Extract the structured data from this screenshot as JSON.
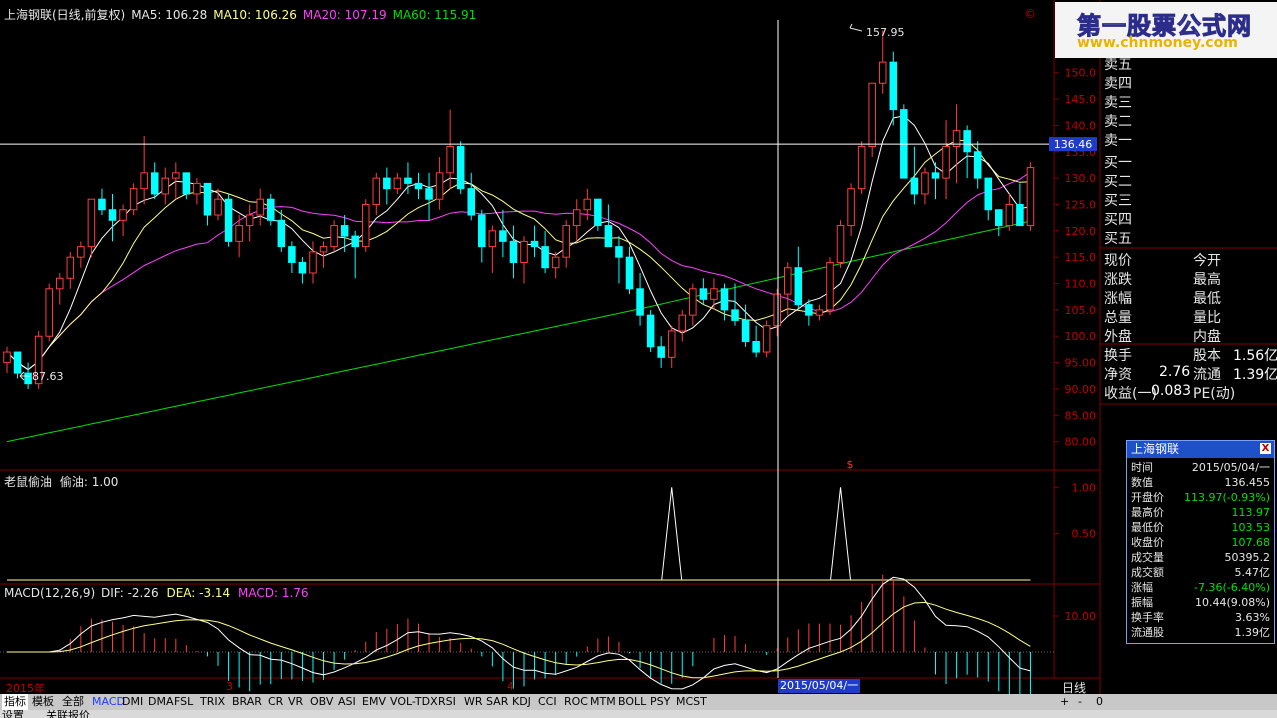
{
  "header": {
    "stock_title": "上海钢联(日线,前复权)",
    "ma5": "MA5: 106.28",
    "ma10": "MA10: 106.26",
    "ma20": "MA20: 107.19",
    "ma60": "MA60: 115.91"
  },
  "colors": {
    "up": "#ff3c3c",
    "down": "#00ffff",
    "ma5": "#ffffff",
    "ma10": "#ffff80",
    "ma20": "#ff40ff",
    "ma60": "#00e000",
    "axis": "#800000",
    "crosshair": "#ffffff"
  },
  "chart_data": [
    {
      "type": "candlestick",
      "title": "上海钢联(日线,前复权)",
      "ylim": [
        75,
        160
      ],
      "y_ticks": [
        "80.00",
        "85.00",
        "90.00",
        "95.00",
        "100.0",
        "105.0",
        "110.0",
        "115.0",
        "120.0",
        "125.0",
        "130.0",
        "135.0",
        "140.0",
        "145.0",
        "150.0"
      ],
      "crosshair_value": "136.46",
      "max_label": "157.95",
      "min_label": "87.63",
      "candles": [
        [
          95,
          98,
          93,
          97
        ],
        [
          97,
          96,
          92,
          93
        ],
        [
          93,
          95,
          90,
          91
        ],
        [
          91,
          101,
          90,
          100
        ],
        [
          100,
          110,
          99,
          109
        ],
        [
          109,
          112,
          106,
          111
        ],
        [
          111,
          116,
          109,
          115
        ],
        [
          115,
          118,
          113,
          117
        ],
        [
          117,
          126,
          115,
          126
        ],
        [
          126,
          128,
          123,
          124
        ],
        [
          124,
          127,
          118,
          122
        ],
        [
          122,
          125,
          119,
          124
        ],
        [
          124,
          129,
          123,
          128
        ],
        [
          128,
          138,
          125,
          131
        ],
        [
          131,
          133,
          126,
          127
        ],
        [
          127,
          132,
          125,
          130
        ],
        [
          130,
          133,
          126,
          131
        ],
        [
          131,
          131,
          126,
          127
        ],
        [
          127,
          130,
          125,
          129
        ],
        [
          129,
          129,
          121,
          123
        ],
        [
          123,
          128,
          122,
          126
        ],
        [
          126,
          127,
          117,
          118
        ],
        [
          118,
          123,
          115,
          121
        ],
        [
          121,
          125,
          118,
          123
        ],
        [
          123,
          128,
          121,
          126
        ],
        [
          126,
          127,
          121,
          122
        ],
        [
          122,
          124,
          116,
          117
        ],
        [
          117,
          118,
          112,
          114
        ],
        [
          114,
          115,
          110,
          112
        ],
        [
          112,
          118,
          110,
          116
        ],
        [
          116,
          118,
          113,
          117
        ],
        [
          117,
          122,
          116,
          121
        ],
        [
          121,
          123,
          116,
          119
        ],
        [
          119,
          120,
          111,
          117
        ],
        [
          117,
          126,
          116,
          125
        ],
        [
          125,
          131,
          123,
          130
        ],
        [
          130,
          132,
          125,
          128
        ],
        [
          128,
          131,
          127,
          130
        ],
        [
          130,
          133,
          127,
          129
        ],
        [
          129,
          131,
          126,
          128
        ],
        [
          128,
          131,
          122,
          126
        ],
        [
          126,
          134,
          124,
          131
        ],
        [
          131,
          143,
          128,
          136
        ],
        [
          136,
          137,
          127,
          128
        ],
        [
          128,
          131,
          122,
          123
        ],
        [
          123,
          124,
          114,
          117
        ],
        [
          117,
          121,
          112,
          120
        ],
        [
          120,
          124,
          115,
          118
        ],
        [
          118,
          121,
          111,
          114
        ],
        [
          114,
          119,
          110,
          118
        ],
        [
          118,
          121,
          115,
          117
        ],
        [
          117,
          120,
          112,
          113
        ],
        [
          113,
          116,
          111,
          115
        ],
        [
          115,
          122,
          113,
          121
        ],
        [
          121,
          126,
          118,
          124
        ],
        [
          124,
          128,
          122,
          126
        ],
        [
          126,
          126,
          120,
          121
        ],
        [
          121,
          125,
          118,
          117
        ],
        [
          117,
          119,
          110,
          115
        ],
        [
          115,
          117,
          108,
          109
        ],
        [
          109,
          112,
          102,
          104
        ],
        [
          104,
          105,
          97,
          98
        ],
        [
          98,
          100,
          94,
          96
        ],
        [
          96,
          102,
          94,
          101
        ],
        [
          101,
          105,
          99,
          104
        ],
        [
          104,
          110,
          102,
          109
        ],
        [
          109,
          111,
          106,
          107
        ],
        [
          107,
          111,
          105,
          109
        ],
        [
          109,
          110,
          103,
          105
        ],
        [
          105,
          110,
          102,
          103
        ],
        [
          103,
          106,
          98,
          99
        ],
        [
          99,
          102,
          96,
          97
        ],
        [
          97,
          103,
          96,
          102
        ],
        [
          102,
          109,
          100,
          108
        ],
        [
          108,
          114,
          104,
          113
        ],
        [
          113,
          117,
          105,
          106
        ],
        [
          106,
          107,
          102,
          104
        ],
        [
          104,
          106,
          103,
          105
        ],
        [
          105,
          115,
          104,
          114
        ],
        [
          114,
          122,
          113,
          121
        ],
        [
          121,
          129,
          119,
          128
        ],
        [
          128,
          137,
          127,
          136
        ],
        [
          136,
          144,
          134,
          148
        ],
        [
          148,
          158,
          146,
          152
        ],
        [
          152,
          154,
          140,
          143
        ],
        [
          143,
          144,
          130,
          130
        ],
        [
          130,
          136,
          125,
          127
        ],
        [
          127,
          132,
          125,
          131
        ],
        [
          131,
          133,
          126,
          130
        ],
        [
          130,
          141,
          126,
          136
        ],
        [
          136,
          144,
          129,
          139
        ],
        [
          139,
          140,
          130,
          135
        ],
        [
          135,
          137,
          128,
          130
        ],
        [
          130,
          128,
          122,
          124
        ],
        [
          124,
          124,
          119,
          121
        ],
        [
          121,
          127,
          120,
          125
        ],
        [
          125,
          129,
          121,
          121
        ],
        [
          121,
          133,
          120,
          132
        ]
      ],
      "series": [
        {
          "name": "MA5"
        },
        {
          "name": "MA10"
        },
        {
          "name": "MA20"
        },
        {
          "name": "MA60"
        }
      ]
    },
    {
      "type": "line",
      "title": "老鼠偷油",
      "series_label": "偷油: 1.00",
      "y_ticks": [
        "0.50",
        "1.00"
      ],
      "ylim": [
        0,
        1.1
      ],
      "spikes_at_index": [
        63,
        79
      ]
    },
    {
      "type": "bar",
      "title": "MACD(12,26,9)",
      "dif_label": "DIF: -2.26",
      "dea_label": "DEA: -3.14",
      "macd_label": "MACD: 1.76",
      "y_ticks": [
        "10.00"
      ]
    }
  ],
  "right_panel": {
    "asks": [
      "卖五",
      "卖四",
      "卖三",
      "卖二",
      "卖一"
    ],
    "bids": [
      "买一",
      "买二",
      "买三",
      "买四",
      "买五"
    ],
    "stats_left": [
      "现价",
      "涨跌",
      "涨幅",
      "总量",
      "外盘"
    ],
    "stats_right": [
      "今开",
      "最高",
      "最低",
      "量比",
      "内盘"
    ],
    "turnover_label": "换手",
    "equity_label": "股本",
    "equity_value": "1.56亿",
    "net_assets_label": "净资",
    "net_assets_value": "2.76",
    "float_label": "流通",
    "float_value": "1.39亿",
    "eps_label": "收益(一)",
    "eps_value": "0.083",
    "pe_label": "PE(动)"
  },
  "info_box": {
    "title": "上海钢联",
    "close": "X",
    "rows": [
      {
        "k": "时间",
        "v": "2015/05/04/一",
        "c": "#e6e6e6"
      },
      {
        "k": "数值",
        "v": "136.455",
        "c": "#e6e6e6"
      },
      {
        "k": "开盘价",
        "v": "113.97(-0.93%)",
        "c": "#00e000"
      },
      {
        "k": "最高价",
        "v": "113.97",
        "c": "#00e000"
      },
      {
        "k": "最低价",
        "v": "103.53",
        "c": "#00e000"
      },
      {
        "k": "收盘价",
        "v": "107.68",
        "c": "#00e000"
      },
      {
        "k": "成交量",
        "v": "50395.2",
        "c": "#e6e6e6"
      },
      {
        "k": "成交额",
        "v": "5.47亿",
        "c": "#e6e6e6"
      },
      {
        "k": "涨幅",
        "v": "-7.36(-6.40%)",
        "c": "#00e000"
      },
      {
        "k": "振幅",
        "v": "10.44(9.08%)",
        "c": "#e6e6e6"
      },
      {
        "k": "换手率",
        "v": "3.63%",
        "c": "#e6e6e6"
      },
      {
        "k": "流通股",
        "v": "1.39亿",
        "c": "#e6e6e6"
      }
    ]
  },
  "time_axis": {
    "start": "2015年",
    "m3": "3",
    "m4": "4",
    "cursor_date": "2015/05/04/一",
    "period": "日线"
  },
  "tabs": [
    "指标",
    "模板",
    "全部",
    "MACD",
    "DMI",
    "DMA",
    "FSL",
    "TRIX",
    "BRAR",
    "CR",
    "VR",
    "OBV",
    "ASI",
    "EMV",
    "VOL-TDX",
    "RSI",
    "WR",
    "SAR",
    "KDJ",
    "CCI",
    "ROC",
    "MTM",
    "BOLL",
    "PSY",
    "MCST"
  ],
  "zoom_controls": [
    "+",
    "-",
    "0"
  ],
  "bottom_tabs": [
    "设置",
    "关联报价"
  ],
  "logo": {
    "line1": "第一股票公式网",
    "line2": "www.chnmoney.com"
  },
  "indicator_panel_label": "老鼠偷油"
}
